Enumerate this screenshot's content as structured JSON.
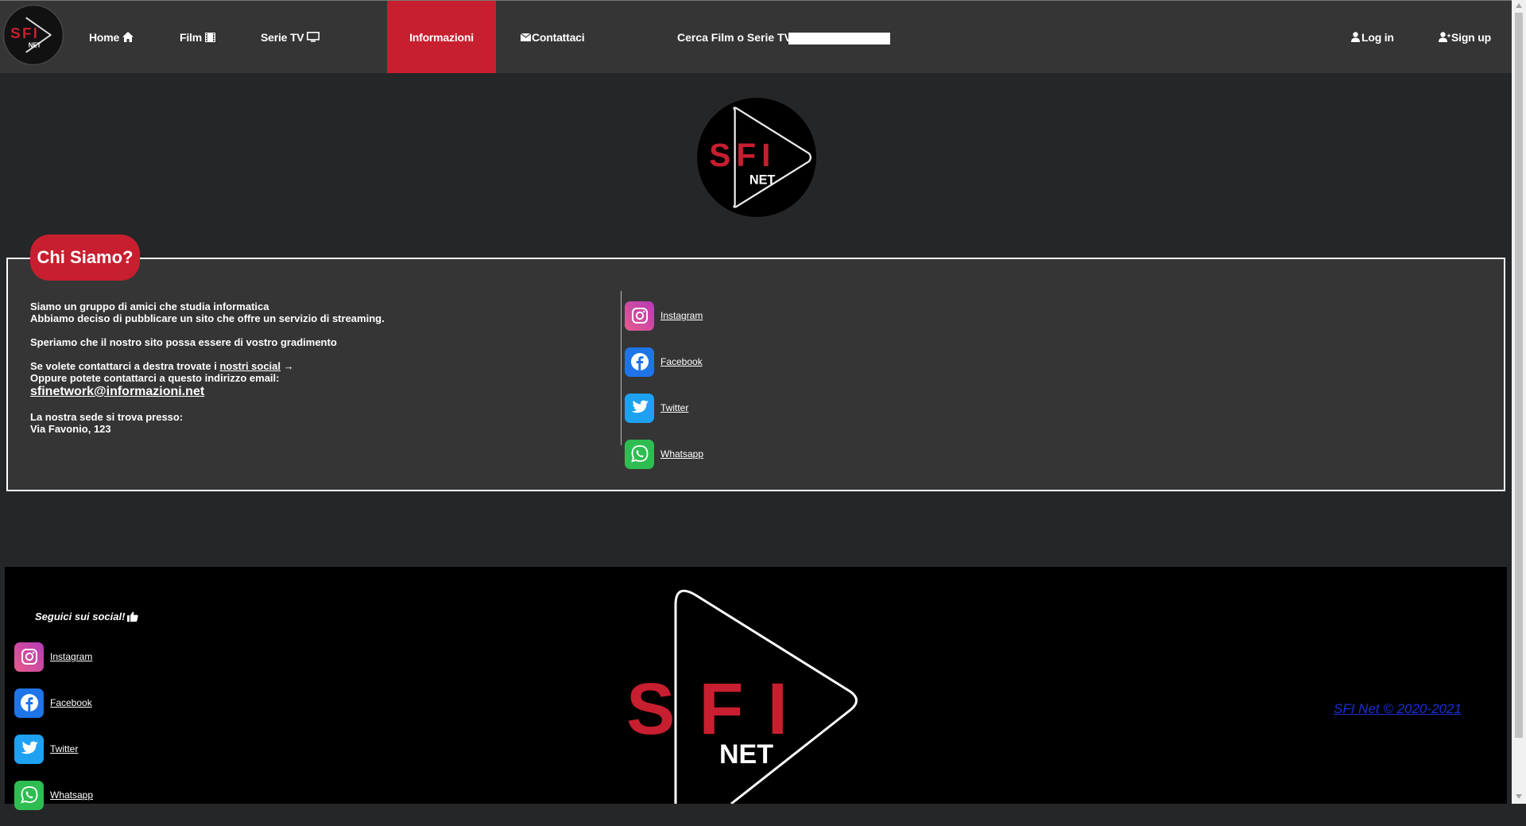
{
  "nav": {
    "logo_alt": "SFI NET",
    "items": [
      {
        "label": "Home",
        "icon": "home-icon"
      },
      {
        "label": "Film",
        "icon": "film-icon"
      },
      {
        "label": "Serie TV",
        "icon": "tv-icon"
      },
      {
        "label": "Informazioni",
        "active": true
      },
      {
        "label": "Contattaci",
        "icon": "envelope-icon"
      }
    ],
    "search_label": "Cerca Film o Serie TV:",
    "search_value": "",
    "login_label": "Log in",
    "signup_label": "Sign up",
    "accent_color": "#c71f2f"
  },
  "about": {
    "title": "Chi Siamo?",
    "line1": "Siamo un gruppo di amici che studia informatica",
    "line2": "Abbiamo deciso di pubblicare un sito che offre un servizio di streaming.",
    "line3": "Speriamo che il nostro sito possa essere di vostro gradimento",
    "line4_prefix": "Se volete contattarci a destra trovate i ",
    "line4_link": "nostri social",
    "line4_suffix": " →",
    "line5": "Oppure potete contattarci a questo indirizzo email:",
    "email": "sfinetwork@informazioni.net",
    "line6": "La nostra sede si trova presso:",
    "address": "Via Favonio, 123"
  },
  "socials": [
    {
      "label": "Instagram",
      "icon": "instagram-icon"
    },
    {
      "label": "Facebook",
      "icon": "facebook-icon"
    },
    {
      "label": "Twitter",
      "icon": "twitter-icon"
    },
    {
      "label": "Whatsapp",
      "icon": "whatsapp-icon"
    }
  ],
  "footer": {
    "title": "Seguici sui social!",
    "copyright": "SFI Net © 2020-2021"
  }
}
